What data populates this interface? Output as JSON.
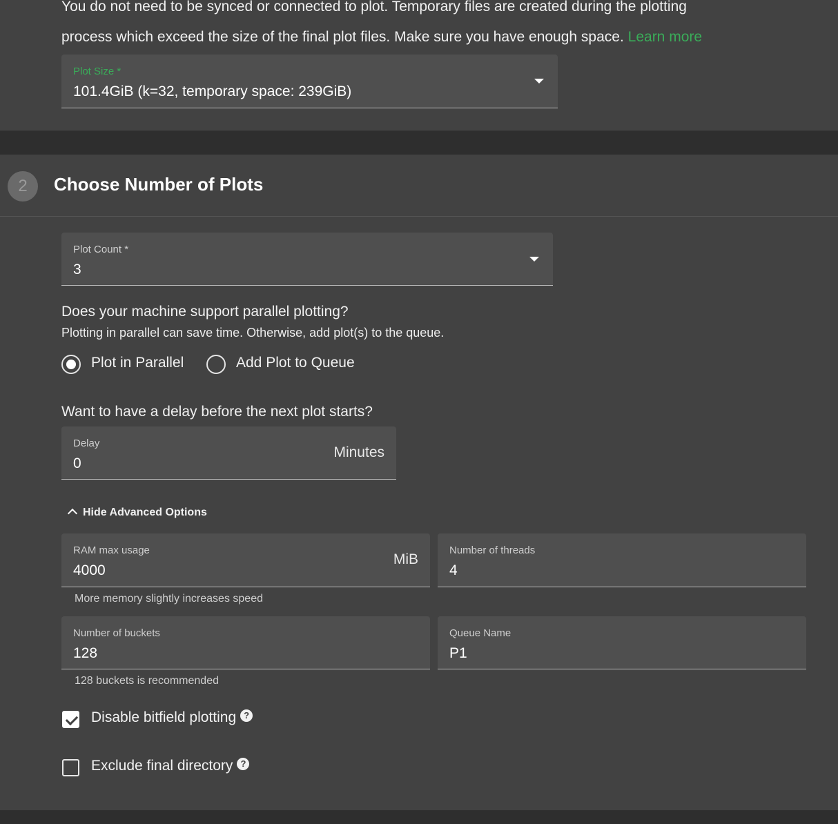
{
  "plot_size_section": {
    "info_line1": "You do not need to be synced or connected to plot. Temporary files are created during the plotting",
    "info_line2": "process which exceed the size of the final plot files. Make sure you have enough space.",
    "learn_more": "Learn more",
    "plot_size_label": "Plot Size *",
    "plot_size_value": "101.4GiB (k=32, temporary space: 239GiB)"
  },
  "step": {
    "number": "2",
    "title": "Choose Number of Plots"
  },
  "plot_count": {
    "label": "Plot Count *",
    "value": "3"
  },
  "parallel": {
    "question": "Does your machine support parallel plotting?",
    "description": "Plotting in parallel can save time. Otherwise, add plot(s) to the queue.",
    "option_parallel": "Plot in Parallel",
    "option_queue": "Add Plot to Queue",
    "selected": "Plot in Parallel"
  },
  "delay": {
    "question": "Want to have a delay before the next plot starts?",
    "label": "Delay",
    "value": "0",
    "unit": "Minutes"
  },
  "advanced": {
    "toggle_label": "Hide Advanced Options",
    "ram_label": "RAM max usage",
    "ram_value": "4000",
    "ram_unit": "MiB",
    "ram_helper": "More memory slightly increases speed",
    "threads_label": "Number of threads",
    "threads_value": "4",
    "buckets_label": "Number of buckets",
    "buckets_value": "128",
    "buckets_helper": "128 buckets is recommended",
    "queue_label": "Queue Name",
    "queue_value": "P1"
  },
  "options": {
    "disable_bitfield_label": "Disable bitfield plotting",
    "disable_bitfield_checked": true,
    "exclude_final_label": "Exclude final directory",
    "exclude_final_checked": false
  },
  "colors": {
    "accent": "#3aac59",
    "panel": "#424242",
    "background": "#2e2e2e"
  }
}
